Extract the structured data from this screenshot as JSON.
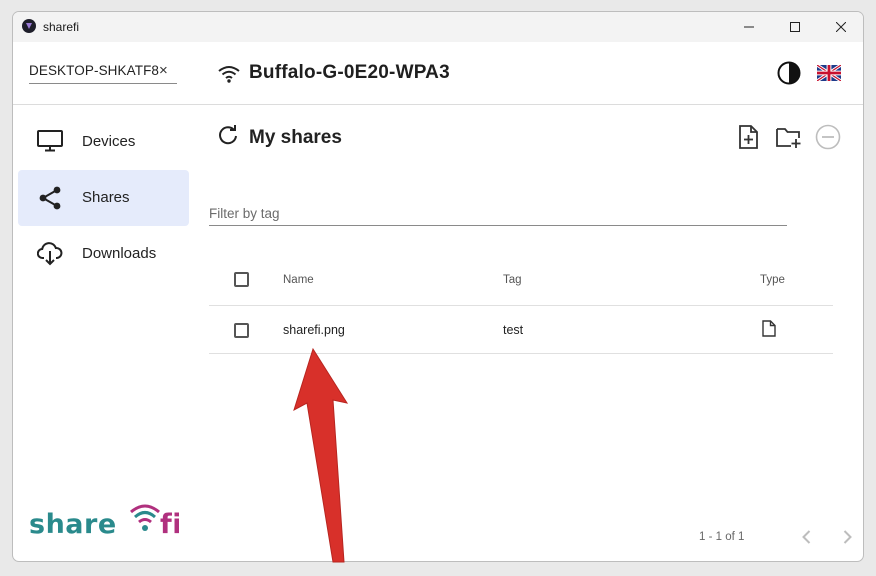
{
  "window": {
    "title": "sharefi"
  },
  "header": {
    "device_name": "DESKTOP-SHKATF8",
    "device_clear": "×",
    "network_name": "Buffalo-G-0E20-WPA3"
  },
  "sidebar": {
    "items": [
      {
        "label": "Devices",
        "icon": "monitor-icon"
      },
      {
        "label": "Shares",
        "icon": "share-icon",
        "active": true
      },
      {
        "label": "Downloads",
        "icon": "cloud-download-icon"
      }
    ],
    "logo": {
      "part1": "share",
      "part2": "fi"
    }
  },
  "main": {
    "title": "My shares",
    "filter_placeholder": "Filter by tag",
    "table": {
      "columns": [
        "Name",
        "Tag",
        "Type"
      ],
      "rows": [
        {
          "name": "sharefi.png",
          "tag": "test",
          "type": "file-icon"
        }
      ]
    },
    "pagination": {
      "range": "1 - 1 of 1"
    }
  },
  "colors": {
    "active_nav_bg": "#e5ebfb",
    "logo_teal": "#2a8a8c",
    "logo_magenta": "#b0307e",
    "annotation_arrow": "#d8302a"
  }
}
